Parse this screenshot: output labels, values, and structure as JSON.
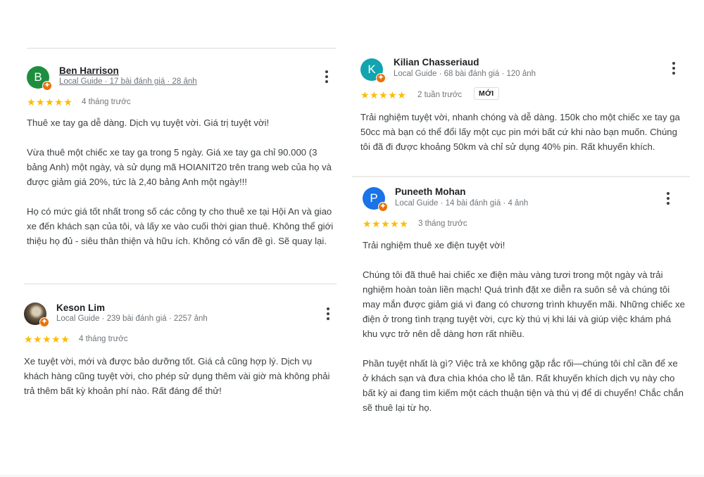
{
  "colors": {
    "avatar_ben": "#1e8e3e",
    "avatar_kilian": "#12a4af",
    "avatar_puneeth": "#1a73e8",
    "star": "#fbbc04",
    "guide_badge": "#e8710a"
  },
  "reviews": [
    {
      "initial": "B",
      "name": "Ben Harrison",
      "meta": "Local Guide · 17 bài đánh giá · 28 ảnh",
      "stars": "★★★★★",
      "rating": 5,
      "time": "4 tháng trước",
      "paragraphs": [
        "Thuê xe tay ga dễ dàng. Dịch vụ tuyệt vời. Giá trị tuyệt vời!",
        "Vừa thuê một chiếc xe tay ga trong 5 ngày. Giá xe tay ga chỉ 90.000 (3 bảng Anh) một ngày, và sử dụng mã HOIANIT20 trên trang web của họ và được giảm giá 20%, tức là 2,40 bảng Anh một ngày!!!",
        "Họ có mức giá tốt nhất trong số các công ty cho thuê xe tại Hội An và giao xe đến khách sạn của tôi, và lấy xe vào cuối thời gian thuê. Không thể giới thiệu họ đủ - siêu thân thiện và hữu ích. Không có vấn đề gì. Sẽ quay lại."
      ]
    },
    {
      "initial": "",
      "name": "Keson Lim",
      "meta": "Local Guide · 239 bài đánh giá · 2257 ảnh",
      "stars": "★★★★★",
      "rating": 5,
      "time": "4 tháng trước",
      "paragraphs": [
        "Xe tuyệt vời, mới và được bảo dưỡng tốt. Giá cả cũng hợp lý. Dịch vụ khách hàng cũng tuyệt vời, cho phép sử dụng thêm vài giờ mà không phải trả thêm bất kỳ khoản phí nào. Rất đáng để thử!"
      ]
    },
    {
      "initial": "K",
      "name": "Kilian Chasseriaud",
      "meta": "Local Guide · 68 bài đánh giá · 120 ảnh",
      "stars": "★★★★★",
      "rating": 5,
      "time": "2 tuần trước",
      "badge": "MỚI",
      "paragraphs": [
        "Trải nghiệm tuyệt vời, nhanh chóng và dễ dàng. 150k cho một chiếc xe tay ga 50cc mà bạn có thể đổi lấy một cục pin mới bất cứ khi nào bạn muốn. Chúng tôi đã đi được khoảng 50km và chỉ sử dụng 40% pin. Rất khuyến khích."
      ]
    },
    {
      "initial": "P",
      "name": "Puneeth Mohan",
      "meta": "Local Guide · 14 bài đánh giá · 4 ảnh",
      "stars": "★★★★★",
      "rating": 5,
      "time": "3 tháng trước",
      "paragraphs": [
        "Trải nghiệm thuê xe điện tuyệt vời!",
        "Chúng tôi đã thuê hai chiếc xe điện màu vàng tươi trong một ngày và trải nghiệm hoàn toàn liền mạch! Quá trình đặt xe diễn ra suôn sẻ và chúng tôi may mắn được giảm giá vì đang có chương trình khuyến mãi. Những chiếc xe điện ở trong tình trạng tuyệt vời, cực kỳ thú vị khi lái và giúp việc khám phá khu vực trở nên dễ dàng hơn rất nhiều.",
        "Phần tuyệt nhất là gì? Việc trả xe không gặp rắc rối—chúng tôi chỉ cần để xe ở khách sạn và đưa chìa khóa cho lễ tân. Rất khuyến khích dịch vụ này cho bất kỳ ai đang tìm kiếm một cách thuận tiện và thú vị để di chuyển! Chắc chắn sẽ thuê lại từ họ."
      ]
    }
  ]
}
